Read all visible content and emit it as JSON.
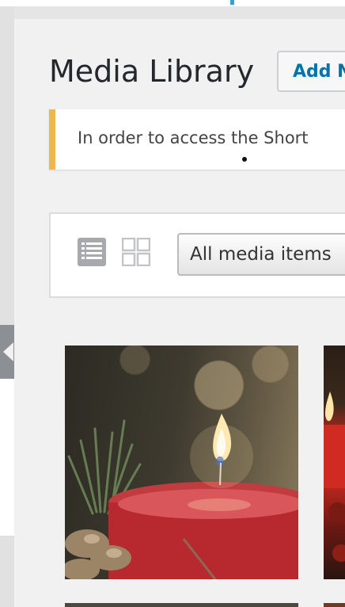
{
  "header": {
    "title": "Media Library",
    "add_new_label": "Add N"
  },
  "notice": {
    "text": "In order to access the Short",
    "accent_color": "#f0b849"
  },
  "toolbar": {
    "list_view_icon": "list-view-icon",
    "grid_view_icon": "grid-view-icon",
    "filter_selected": "All media items"
  },
  "media_grid": {
    "items": [
      {
        "subject": "red candle with flame and pine branch"
      },
      {
        "subject": "red candle with ornaments"
      },
      {
        "subject": "photo"
      },
      {
        "subject": "photo"
      }
    ]
  },
  "colors": {
    "link_blue": "#0073aa",
    "page_bg": "#f1f1f1",
    "admin_rail": "#e1e1e1"
  }
}
